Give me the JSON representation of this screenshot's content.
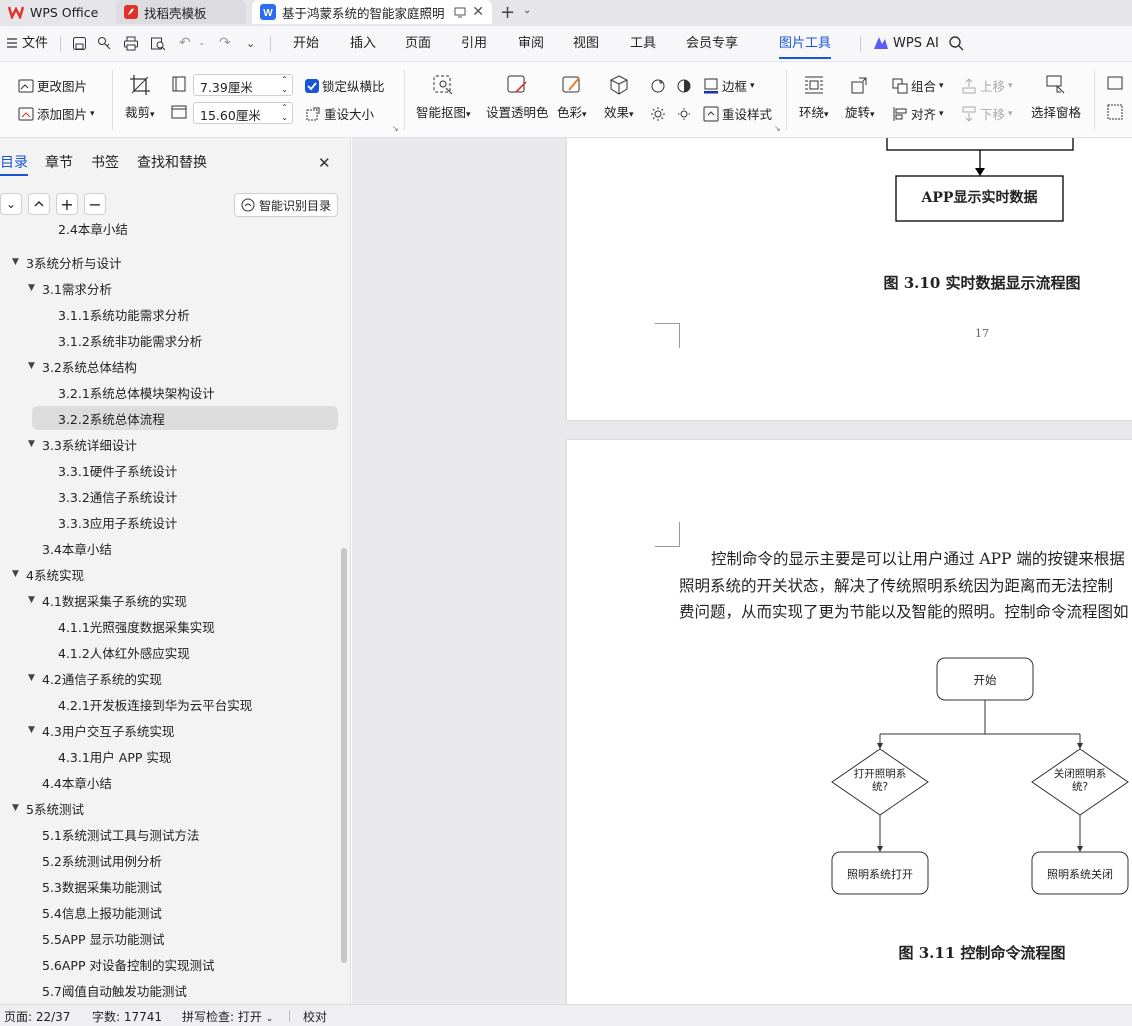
{
  "tabs": {
    "wps": "WPS Office",
    "daoke": "找稻壳模板",
    "doc": "基于鸿蒙系统的智能家庭照明"
  },
  "menu": {
    "file": "文件",
    "items": [
      "开始",
      "插入",
      "页面",
      "引用",
      "审阅",
      "视图",
      "工具",
      "会员专享",
      "图片工具",
      "WPS AI"
    ]
  },
  "ribbon": {
    "change_pic": "更改图片",
    "add_pic": "添加图片",
    "crop": "裁剪",
    "width_val": "7.39厘米",
    "height_val": "15.60厘米",
    "lock_ratio": "锁定纵横比",
    "reset_size": "重设大小",
    "smart_cutout": "智能抠图",
    "set_transparent": "设置透明色",
    "color": "色彩",
    "effect": "效果",
    "border": "边框",
    "reset_style": "重设样式",
    "wrap": "环绕",
    "rotate": "旋转",
    "group": "组合",
    "align": "对齐",
    "move_up": "上移",
    "move_down": "下移",
    "select_pane": "选择窗格"
  },
  "panel": {
    "tabs": [
      "目录",
      "章节",
      "书签",
      "查找和替换"
    ],
    "smart_toc": "智能识别目录",
    "items": [
      {
        "label": "2.4本章小结",
        "level": 2,
        "arrow": false
      },
      {
        "label": "3系统分析与设计",
        "level": 0,
        "arrow": true
      },
      {
        "label": "3.1需求分析",
        "level": 1,
        "arrow": true
      },
      {
        "label": "3.1.1系统功能需求分析",
        "level": 2,
        "arrow": false
      },
      {
        "label": "3.1.2系统非功能需求分析",
        "level": 2,
        "arrow": false
      },
      {
        "label": "3.2系统总体结构",
        "level": 1,
        "arrow": true
      },
      {
        "label": "3.2.1系统总体模块架构设计",
        "level": 2,
        "arrow": false
      },
      {
        "label": "3.2.2系统总体流程",
        "level": 2,
        "arrow": false,
        "selected": true
      },
      {
        "label": "3.3系统详细设计",
        "level": 1,
        "arrow": true
      },
      {
        "label": "3.3.1硬件子系统设计",
        "level": 2,
        "arrow": false
      },
      {
        "label": "3.3.2通信子系统设计",
        "level": 2,
        "arrow": false
      },
      {
        "label": "3.3.3应用子系统设计",
        "level": 2,
        "arrow": false
      },
      {
        "label": "3.4本章小结",
        "level": 1,
        "arrow": false
      },
      {
        "label": "4系统实现",
        "level": 0,
        "arrow": true
      },
      {
        "label": "4.1数据采集子系统的实现",
        "level": 1,
        "arrow": true
      },
      {
        "label": "4.1.1光照强度数据采集实现",
        "level": 2,
        "arrow": false
      },
      {
        "label": "4.1.2人体红外感应实现",
        "level": 2,
        "arrow": false
      },
      {
        "label": "4.2通信子系统的实现",
        "level": 1,
        "arrow": true
      },
      {
        "label": "4.2.1开发板连接到华为云平台实现",
        "level": 2,
        "arrow": false
      },
      {
        "label": "4.3用户交互子系统实现",
        "level": 1,
        "arrow": true
      },
      {
        "label": "4.3.1用户 APP 实现",
        "level": 2,
        "arrow": false
      },
      {
        "label": "4.4本章小结",
        "level": 1,
        "arrow": false
      },
      {
        "label": "5系统测试",
        "level": 0,
        "arrow": true
      },
      {
        "label": "5.1系统测试工具与测试方法",
        "level": 1,
        "arrow": false
      },
      {
        "label": "5.2系统测试用例分析",
        "level": 1,
        "arrow": false
      },
      {
        "label": "5.3数据采集功能测试",
        "level": 1,
        "arrow": false
      },
      {
        "label": "5.4信息上报功能测试",
        "level": 1,
        "arrow": false
      },
      {
        "label": "5.5APP 显示功能测试",
        "level": 1,
        "arrow": false
      },
      {
        "label": "5.6APP 对设备控制的实现测试",
        "level": 1,
        "arrow": false
      },
      {
        "label": "5.7阈值自动触发功能测试",
        "level": 1,
        "arrow": false
      }
    ]
  },
  "doc": {
    "box_app": "APP显示实时数据",
    "fig310": "图 3.10 实时数据显示流程图",
    "page_num": "17",
    "para1": "控制命令的显示主要是可以让用户通过 APP 端的按键来根据",
    "para2": "照明系统的开关状态，解决了传统照明系统因为距离而无法控制",
    "para3": "费问题，从而实现了更为节能以及智能的照明。控制命令流程图如",
    "fc_start": "开始",
    "fc_open_q1": "打开照明系",
    "fc_open_q2": "统?",
    "fc_close_q1": "关闭照明系",
    "fc_close_q2": "统?",
    "fc_on": "照明系统打开",
    "fc_off": "照明系统关闭",
    "fig311": "图 3.11 控制命令流程图"
  },
  "status": {
    "page": "页面: 22/37",
    "words": "字数: 17741",
    "spell": "拼写检查: 打开",
    "proof": "校对"
  },
  "colors": {
    "accent": "#1a55d6",
    "wps_red": "#e0302a"
  }
}
